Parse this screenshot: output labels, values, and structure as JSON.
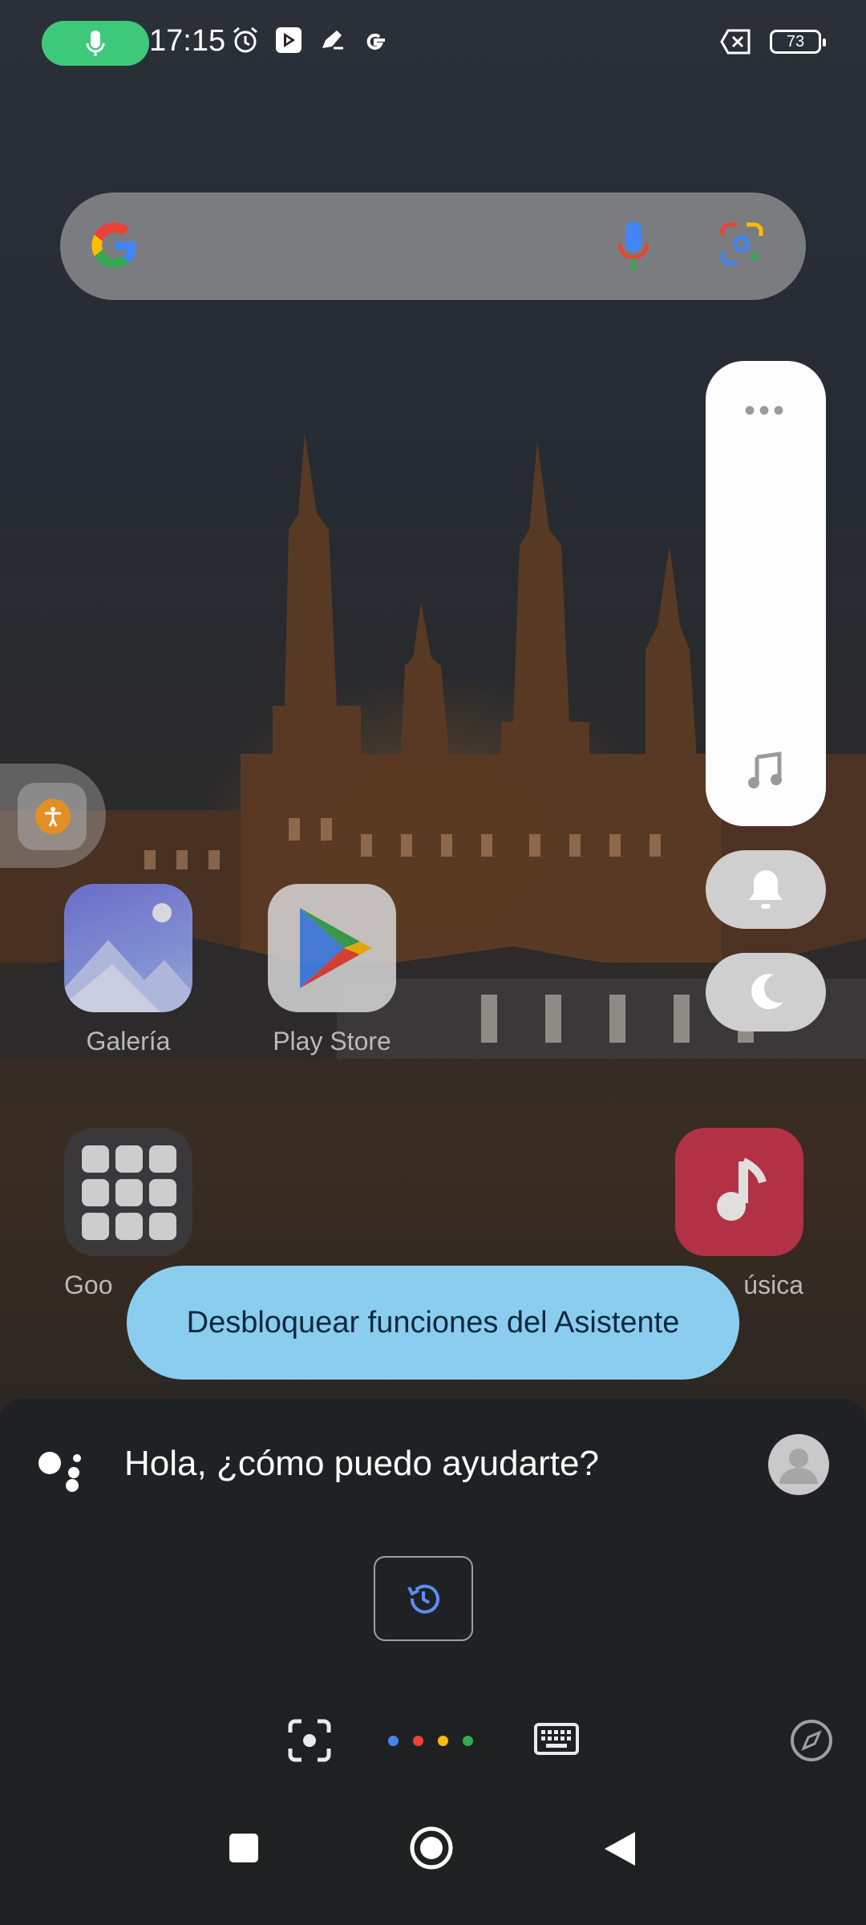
{
  "status_bar": {
    "time": "17:15",
    "battery": "73"
  },
  "apps": [
    {
      "label": "Galería"
    },
    {
      "label": "Play Store"
    },
    {
      "label": "Goo"
    },
    {
      "label": "úsica"
    }
  ],
  "assistant": {
    "unlock_prompt": "Desbloquear funciones del Asistente",
    "greeting": "Hola, ¿cómo puedo ayudarte?"
  },
  "colors": {
    "mic_pill": "#3ec97a",
    "bubble": "#8bcdee",
    "google_blue": "#4285f4",
    "google_red": "#ea4335",
    "google_yellow": "#fbbc05",
    "google_green": "#34a853"
  },
  "icons": [
    "mic-icon",
    "alarm-icon",
    "play-icon",
    "pen-icon",
    "google-g-icon",
    "sim-off-icon",
    "battery-icon",
    "google-logo-icon",
    "voice-search-icon",
    "lens-icon",
    "more-dots-icon",
    "music-note-icon",
    "bell-icon",
    "moon-icon",
    "accessibility-icon",
    "assistant-logo-icon",
    "avatar-icon",
    "history-icon",
    "camera-lens-icon",
    "keyboard-icon",
    "compass-icon",
    "recents-icon",
    "home-icon",
    "back-icon"
  ]
}
